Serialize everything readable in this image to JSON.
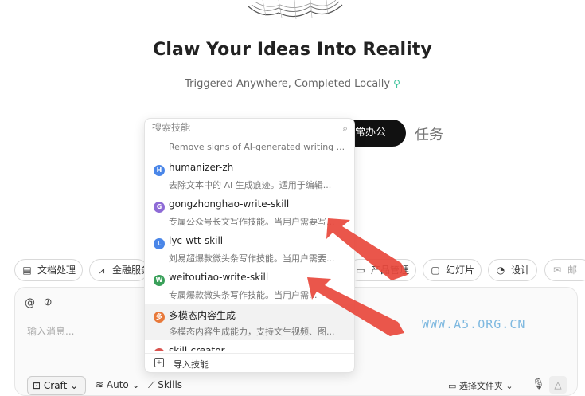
{
  "hero": {
    "title": "Claw Your Ideas Into Reality",
    "subtitle": "Triggered Anywhere, Completed Locally",
    "subtitle_icon": "map-pin-icon"
  },
  "mode_pill": {
    "label": "常办公"
  },
  "task_label": "任务",
  "chips": [
    {
      "label": "文档处理",
      "icon": "document-icon"
    },
    {
      "label": "金融服务",
      "icon": "chart-icon"
    },
    {
      "label": "产品管理",
      "icon": "folder-icon"
    },
    {
      "label": "幻灯片",
      "icon": "presentation-icon"
    },
    {
      "label": "设计",
      "icon": "palette-icon"
    },
    {
      "label": "邮",
      "icon": "mail-icon"
    }
  ],
  "skill_popup": {
    "search_placeholder": "搜索技能",
    "top_desc": "Remove signs of AI-generated writing ...",
    "items": [
      {
        "badge": "H",
        "name": "humanizer-zh",
        "desc": "去除文本中的 AI 生成痕迹。适用于编辑...",
        "color": "#4a86e8"
      },
      {
        "badge": "G",
        "name": "gongzhonghao-write-skill",
        "desc": "专属公众号长文写作技能。当用户需要写...",
        "color": "#8e6bd6"
      },
      {
        "badge": "L",
        "name": "lyc-wtt-skill",
        "desc": "刘易超爆款微头条写作技能。当用户需要...",
        "color": "#4a86e8"
      },
      {
        "badge": "W",
        "name": "weitoutiao-write-skill",
        "desc": "专属爆款微头条写作技能。当用户需...",
        "color": "#3aa05a"
      },
      {
        "badge": "多",
        "name": "多模态内容生成",
        "desc": "多模态内容生成能力，支持文生视频、图...",
        "color": "#e8793a"
      },
      {
        "badge": "S",
        "name": "skill-creator",
        "desc": "",
        "color": "#d9534f"
      }
    ],
    "footer_label": "导入技能"
  },
  "composer": {
    "placeholder": "输入消息..."
  },
  "toolbar": {
    "craft_label": "Craft",
    "auto_label": "Auto",
    "skills_label": "Skills",
    "folder_label": "选择文件夹"
  },
  "watermark": "WWW.A5.ORG.CN"
}
